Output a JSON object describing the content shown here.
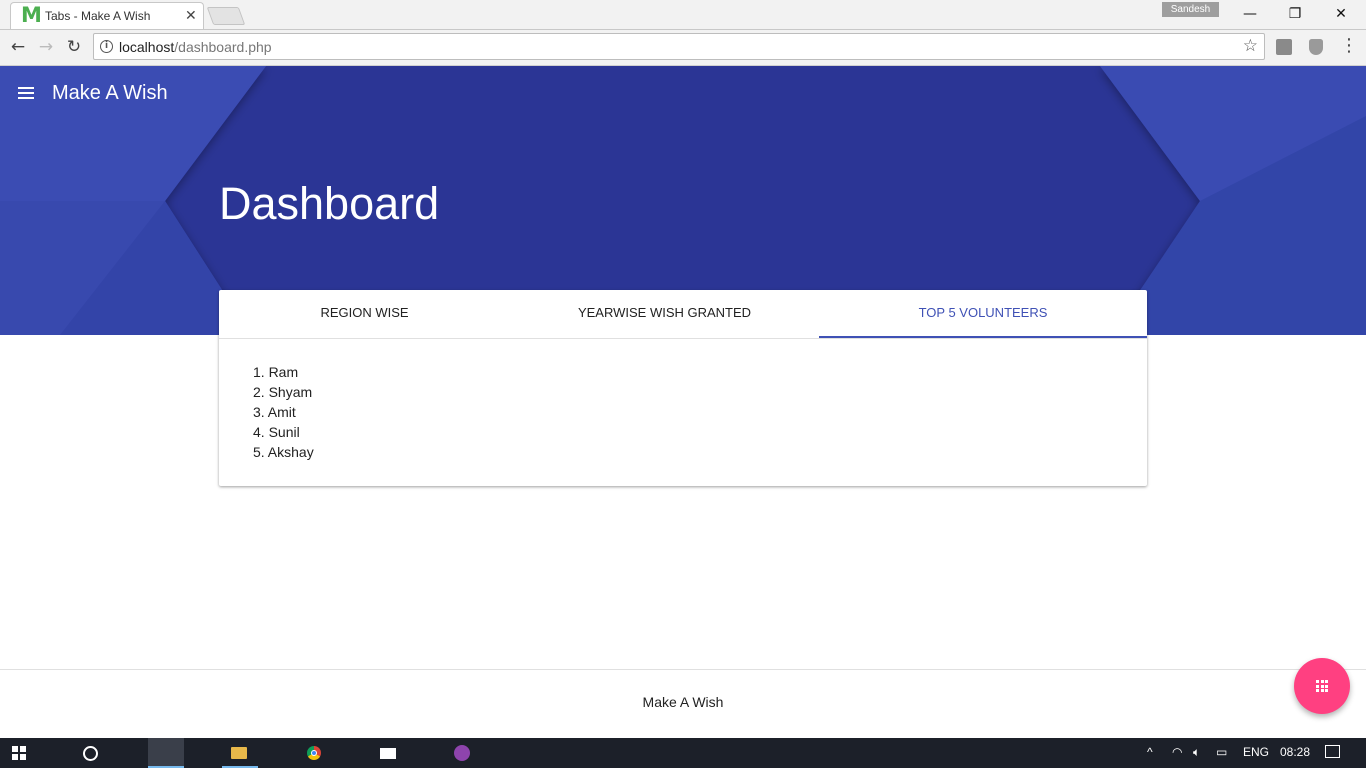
{
  "browser": {
    "tab_title": "Tabs - Make A Wish",
    "tab_favicon": "M",
    "profile_name": "Sandesh",
    "url_host": "localhost",
    "url_path": "/dashboard.php"
  },
  "app": {
    "brand": "Make A Wish",
    "page_title": "Dashboard",
    "accent_color": "#3f51b5",
    "header_color": "#2b3595",
    "fab_color": "#ff4081"
  },
  "tabs": [
    {
      "label": "REGION WISE",
      "active": false
    },
    {
      "label": "YEARWISE WISH GRANTED",
      "active": false
    },
    {
      "label": "TOP 5 VOLUNTEERS",
      "active": true
    }
  ],
  "volunteers": [
    "1. Ram",
    "2. Shyam",
    "3. Amit",
    "4. Sunil",
    "5. Akshay"
  ],
  "footer": {
    "text": "Make A Wish"
  },
  "taskbar": {
    "language": "ENG",
    "time": "08:28"
  },
  "icons": [
    "menu-icon",
    "apps-grid-icon",
    "back-arrow-icon",
    "forward-arrow-icon",
    "reload-icon",
    "info-icon",
    "star-icon",
    "more-vert-icon"
  ]
}
